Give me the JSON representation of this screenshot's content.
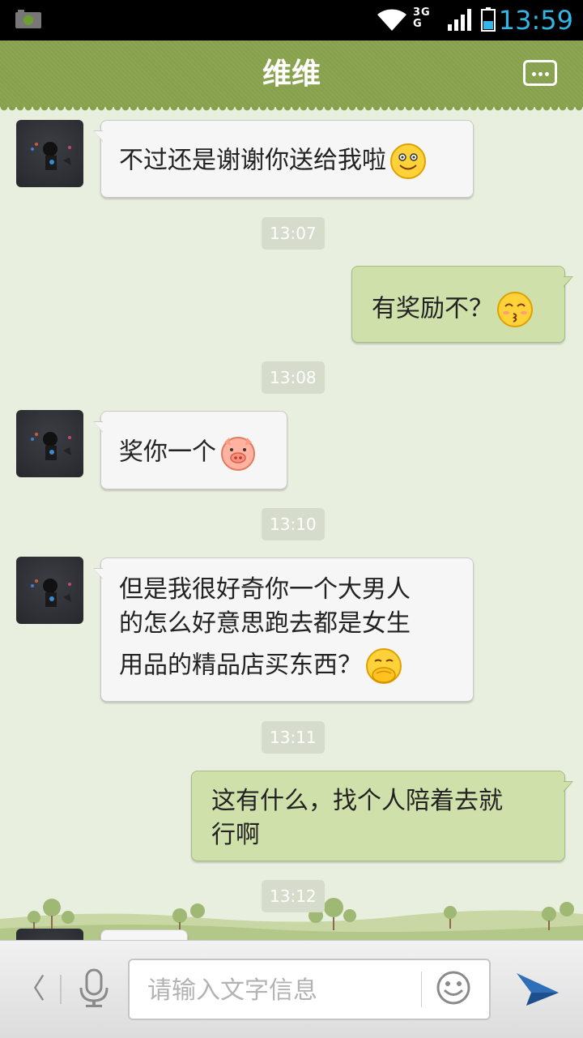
{
  "status_bar": {
    "time": "13:59",
    "network_label": "3G",
    "network_sub": "G",
    "battery_level": 0.4,
    "icons": [
      "android-screenshot-icon",
      "wifi-icon",
      "3g-data-icon",
      "signal-bars-icon",
      "battery-icon"
    ]
  },
  "header": {
    "title": "维维",
    "more_icon": "more-dots-icon"
  },
  "messages": [
    {
      "direction": "in",
      "text": "不过还是谢谢你送给我啦",
      "emoji": "smile-emoji"
    },
    {
      "timestamp": "13:07"
    },
    {
      "direction": "out",
      "text": "有奖励不？",
      "emoji": "kiss-emoji"
    },
    {
      "timestamp": "13:08"
    },
    {
      "direction": "in",
      "text": "奖你一个",
      "emoji": "pig-emoji"
    },
    {
      "timestamp": "13:10"
    },
    {
      "direction": "in",
      "text_line1": "但是我很好奇你一个大男人",
      "text_line2": "的怎么好意思跑去都是女生",
      "text_line3": "用品的精品店买东西？",
      "emoji": "shy-emoji"
    },
    {
      "timestamp": "13:11"
    },
    {
      "direction": "out",
      "text_line1": "这有什么，找个人陪着去就",
      "text_line2": "行啊"
    },
    {
      "timestamp": "13:12"
    }
  ],
  "input_bar": {
    "back_label": "〈",
    "placeholder": "请输入文字信息",
    "icons": [
      "mic-icon",
      "smiley-icon",
      "send-icon"
    ]
  },
  "colors": {
    "header_green": "#86a04b",
    "chat_bg": "#e9efdf",
    "outgoing_bubble": "#cfe0ab",
    "incoming_bubble": "#f6f6f6",
    "status_time": "#33b5e5"
  }
}
